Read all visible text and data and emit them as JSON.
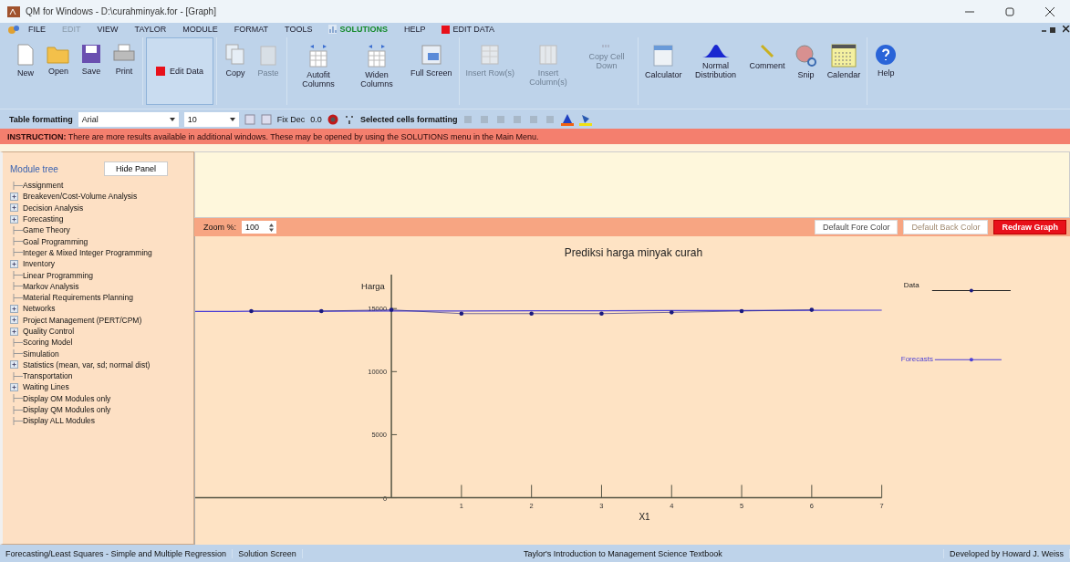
{
  "window": {
    "title": "QM for Windows - D:\\curahminyak.for - [Graph]"
  },
  "menu": [
    {
      "label": "FILE",
      "kind": "plain",
      "disabled": false
    },
    {
      "label": "EDIT",
      "kind": "plain",
      "disabled": true
    },
    {
      "label": "VIEW",
      "kind": "plain",
      "disabled": false
    },
    {
      "label": "TAYLOR",
      "kind": "plain",
      "disabled": false
    },
    {
      "label": "MODULE",
      "kind": "plain",
      "disabled": false
    },
    {
      "label": "FORMAT",
      "kind": "plain",
      "disabled": false
    },
    {
      "label": "TOOLS",
      "kind": "plain",
      "disabled": false
    },
    {
      "label": "SOLUTIONS",
      "kind": "solutions",
      "disabled": false
    },
    {
      "label": "HELP",
      "kind": "plain",
      "disabled": false
    },
    {
      "label": "EDIT DATA",
      "kind": "edit_data",
      "disabled": false
    }
  ],
  "toolbar": {
    "groups": [
      [
        {
          "label": "New",
          "disabled": false,
          "selected": false
        },
        {
          "label": "Open",
          "disabled": false,
          "selected": false
        },
        {
          "label": "Save",
          "disabled": false,
          "selected": false
        },
        {
          "label": "Print",
          "disabled": false,
          "selected": false
        }
      ],
      [
        {
          "label": "Edit Data",
          "disabled": false,
          "selected": true
        }
      ],
      [
        {
          "label": "Copy",
          "disabled": false,
          "selected": false
        },
        {
          "label": "Paste",
          "disabled": true,
          "selected": false
        }
      ],
      [
        {
          "label": "Autofit Columns",
          "disabled": false,
          "selected": false
        },
        {
          "label": "Widen Columns",
          "disabled": false,
          "selected": false
        },
        {
          "label": "Full Screen",
          "disabled": false,
          "selected": false
        }
      ],
      [
        {
          "label": "Insert Row(s)",
          "disabled": true,
          "selected": false
        },
        {
          "label": "Insert Column(s)",
          "disabled": true,
          "selected": false
        },
        {
          "label": "Copy Cell Down",
          "disabled": true,
          "selected": false
        }
      ],
      [
        {
          "label": "Calculator",
          "disabled": false,
          "selected": false
        },
        {
          "label": "Normal Distribution",
          "disabled": false,
          "selected": false
        },
        {
          "label": "Comment",
          "disabled": false,
          "selected": false
        },
        {
          "label": "Snip",
          "disabled": false,
          "selected": false
        },
        {
          "label": "Calendar",
          "disabled": false,
          "selected": false
        }
      ],
      [
        {
          "label": "Help",
          "disabled": false,
          "selected": false
        }
      ]
    ]
  },
  "formatting": {
    "label": "Table formatting",
    "font": "Arial",
    "size": "10",
    "fix_dec": "Fix Dec",
    "decimals": "0.0",
    "selected_label": "Selected cells formatting"
  },
  "instruction": {
    "heading": "INSTRUCTION:",
    "text": "There are more results available in additional windows. These may be opened by using the SOLUTIONS menu in the Main Menu."
  },
  "module_tree": {
    "title": "Module tree",
    "hide_button": "Hide Panel",
    "items": [
      {
        "label": "Assignment",
        "kind": "leaf"
      },
      {
        "label": "Breakeven/Cost-Volume Analysis",
        "kind": "folder"
      },
      {
        "label": "Decision Analysis",
        "kind": "folder"
      },
      {
        "label": "Forecasting",
        "kind": "folder"
      },
      {
        "label": "Game Theory",
        "kind": "leaf"
      },
      {
        "label": "Goal Programming",
        "kind": "leaf"
      },
      {
        "label": "Integer & Mixed Integer Programming",
        "kind": "leaf"
      },
      {
        "label": "Inventory",
        "kind": "folder"
      },
      {
        "label": "Linear Programming",
        "kind": "leaf"
      },
      {
        "label": "Markov Analysis",
        "kind": "leaf"
      },
      {
        "label": "Material Requirements Planning",
        "kind": "leaf"
      },
      {
        "label": "Networks",
        "kind": "folder"
      },
      {
        "label": "Project Management (PERT/CPM)",
        "kind": "folder"
      },
      {
        "label": "Quality Control",
        "kind": "folder"
      },
      {
        "label": "Scoring Model",
        "kind": "leaf"
      },
      {
        "label": "Simulation",
        "kind": "leaf"
      },
      {
        "label": "Statistics (mean, var, sd; normal dist)",
        "kind": "folder"
      },
      {
        "label": "Transportation",
        "kind": "leaf"
      },
      {
        "label": "Waiting Lines",
        "kind": "folder"
      },
      {
        "label": "Display OM Modules only",
        "kind": "leaf"
      },
      {
        "label": "Display QM Modules only",
        "kind": "leaf"
      },
      {
        "label": "Display ALL Modules",
        "kind": "leaf"
      }
    ]
  },
  "graph_toolbar": {
    "zoom_label": "Zoom %:",
    "zoom": "100",
    "buttons": [
      {
        "label": "Default Fore Color",
        "kind": "plain"
      },
      {
        "label": "Default Back Color",
        "kind": "muted"
      },
      {
        "label": "Redraw Graph",
        "kind": "primary"
      }
    ]
  },
  "graph": {
    "chart_data": {
      "type": "line",
      "title": "Prediksi harga minyak curah",
      "xlabel": "X1",
      "ylabel": "Harga",
      "x": [
        -2.8,
        -2,
        -1,
        0,
        1,
        2,
        3,
        4,
        5,
        6,
        7
      ],
      "xlim": [
        -2.8,
        7
      ],
      "ylim": [
        0,
        17700
      ],
      "xticks": [
        1,
        2,
        3,
        4,
        5,
        6,
        7
      ],
      "yticks": [
        0,
        5000,
        10000,
        15000
      ],
      "series": [
        {
          "name": "Data",
          "color": "#1a1a80",
          "values": [
            null,
            14800,
            14800,
            14900,
            14600,
            14600,
            14600,
            14700,
            14800,
            14900,
            null
          ]
        },
        {
          "name": "Forecasts",
          "color": "#4b3fd6",
          "values": [
            14770,
            14780,
            14790,
            14800,
            14810,
            14820,
            14830,
            14840,
            14850,
            14860,
            14870
          ]
        }
      ]
    }
  },
  "status_bar": [
    "Forecasting/Least Squares - Simple and Multiple Regression",
    "Solution Screen",
    "Taylor's Introduction to Management Science Textbook",
    "Developed by Howard J. Weiss"
  ]
}
